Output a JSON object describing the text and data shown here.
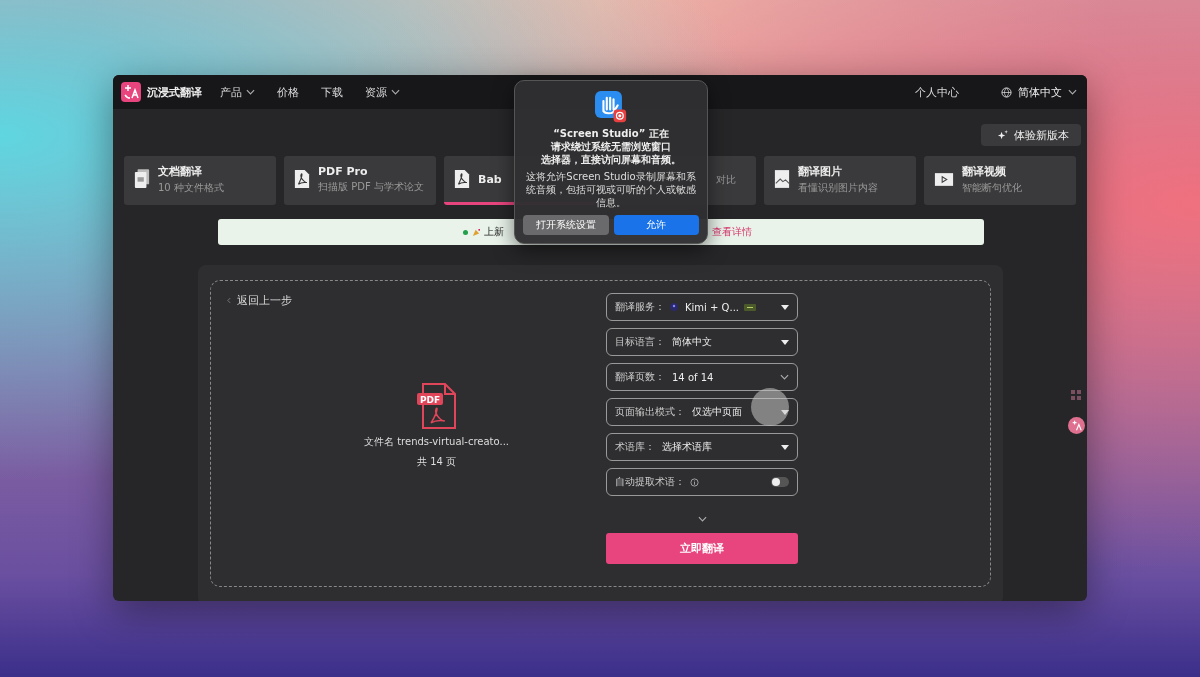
{
  "nav": {
    "brand": "沉浸式翻译",
    "items": [
      {
        "label": "产品",
        "dropdown": true
      },
      {
        "label": "价格",
        "dropdown": false
      },
      {
        "label": "下载",
        "dropdown": false
      },
      {
        "label": "资源",
        "dropdown": true
      }
    ],
    "account": "个人中心",
    "language": "简体中文"
  },
  "try_new_button": "体验新版本",
  "cards": [
    {
      "kind": "document",
      "title": "文档翻译",
      "subtitle": "10 种文件格式",
      "selected": false
    },
    {
      "kind": "pdf",
      "title": "PDF Pro",
      "subtitle": "扫描版 PDF 与学术论文",
      "selected": false
    },
    {
      "kind": "pdf",
      "title": "Bab",
      "selected": true
    },
    {
      "subtitle": "对比",
      "selected": false
    },
    {
      "kind": "image",
      "title": "翻译图片",
      "subtitle": "看懂识别图片内容",
      "selected": false
    },
    {
      "kind": "video",
      "title": "翻译视频",
      "subtitle": "智能断句优化",
      "selected": false
    }
  ],
  "banner": {
    "text": "上新",
    "link": "查看详情"
  },
  "upload": {
    "back": "返回上一步",
    "file_badge": "PDF",
    "file_name": "文件名 trends-virtual-creato...",
    "pages": "共 14 页"
  },
  "form": [
    {
      "kind": "select",
      "label": "翻译服务：",
      "value": "Kimi + Q...",
      "service_icon": true
    },
    {
      "kind": "select",
      "label": "目标语言：",
      "value": "简体中文"
    },
    {
      "kind": "range",
      "label": "翻译页数：",
      "value": "14 of 14"
    },
    {
      "kind": "select",
      "label": "页面输出模式：",
      "value": "仅选中页面"
    },
    {
      "kind": "select",
      "label": "术语库：",
      "value": "选择术语库"
    },
    {
      "kind": "toggle",
      "label": "自动提取术语：",
      "on": false
    }
  ],
  "translate_button": "立即翻译",
  "dialog": {
    "title_lines": [
      "“Screen Studio” 正在",
      "请求绕过系统无需浏览窗口",
      "选择器，直接访问屏幕和音频。"
    ],
    "body": "这将允许Screen Studio录制屏幕和系统音频，包括可视或可听的个人或敏感信息。",
    "buttons": [
      {
        "label": "打开系统设置",
        "kind": "secondary"
      },
      {
        "label": "允许",
        "kind": "primary"
      }
    ]
  }
}
